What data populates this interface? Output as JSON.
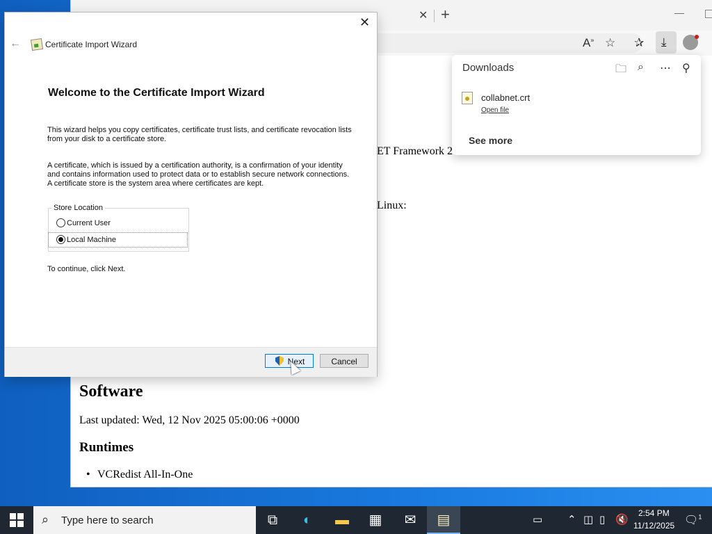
{
  "browser": {
    "page_fragments": [
      "ET Framework 2",
      "Linux:"
    ],
    "software_heading": "Software",
    "last_updated": "Last updated: Wed, 12 Nov 2025 05:00:06 +0000",
    "runtimes_heading": "Runtimes",
    "first_bullet": "VCRedist All-In-One"
  },
  "downloads": {
    "title": "Downloads",
    "file_name": "collabnet.crt",
    "open_file": "Open file",
    "see_more": "See more"
  },
  "wizard": {
    "window_title": "Certificate Import Wizard",
    "heading": "Welcome to the Certificate Import Wizard",
    "intro": "This wizard helps you copy certificates, certificate trust lists, and certificate revocation lists from your disk to a certificate store.",
    "description": "A certificate, which is issued by a certification authority, is a confirmation of your identity and contains information used to protect data or to establish secure network connections. A certificate store is the system area where certificates are kept.",
    "store_location_label": "Store Location",
    "options": [
      {
        "label": "Current User",
        "selected": false
      },
      {
        "label": "Local Machine",
        "selected": true
      }
    ],
    "continue_text": "To continue, click Next.",
    "next_label": "Next",
    "cancel_label": "Cancel"
  },
  "taskbar": {
    "search_placeholder": "Type here to search",
    "time": "2:54 PM",
    "date": "11/12/2025",
    "notification_count": "1"
  }
}
